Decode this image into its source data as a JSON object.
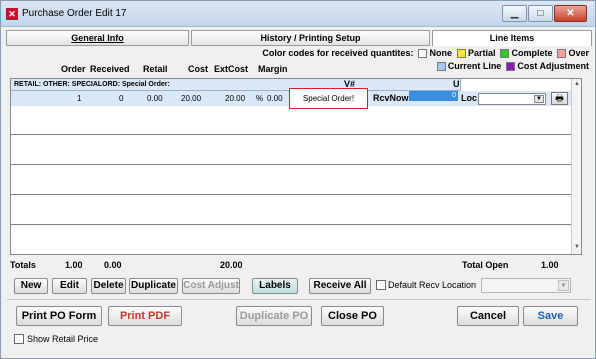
{
  "window": {
    "title": "Purchase Order Edit 17"
  },
  "tabs": {
    "general": "General Info",
    "history": "History / Printing Setup",
    "line_items": "Line Items"
  },
  "color_codes": {
    "label": "Color codes for received quantites:",
    "items": [
      {
        "label": "None",
        "color": "#ffffff"
      },
      {
        "label": "Partial",
        "color": "#f3ea22"
      },
      {
        "label": "Complete",
        "color": "#32c832"
      },
      {
        "label": "Over",
        "color": "#f3a0a0"
      }
    ],
    "row2": [
      {
        "label": "Current Line",
        "color": "#a8c8f0"
      },
      {
        "label": "Cost Adjustment",
        "color": "#8a1ea8"
      }
    ]
  },
  "columns": {
    "order": "Order",
    "received": "Received",
    "retail": "Retail",
    "cost": "Cost",
    "extcost": "ExtCost",
    "margin": "Margin"
  },
  "line": {
    "description": "RETAIL: OTHER: SPECIALORD: Special Order:",
    "vnum_label": "V#",
    "upc_label": "UPC",
    "order": "1",
    "received": "0",
    "retail": "0.00",
    "cost": "20.00",
    "extcost": "20.00",
    "margin_unit": "%",
    "margin": "0.00",
    "special": "Special Order!",
    "rcvnow_label": "RcvNow",
    "rcvnow_value": "0",
    "loc_label": "Loc"
  },
  "totals": {
    "label": "Totals",
    "order": "1.00",
    "received": "0.00",
    "extcost": "20.00",
    "open_label": "Total Open",
    "open_value": "1.00"
  },
  "buttons": {
    "new": "New",
    "edit": "Edit",
    "delete": "Delete",
    "duplicate": "Duplicate",
    "cost_adjust": "Cost Adjust",
    "labels": "Labels",
    "receive_all": "Receive All",
    "print_po": "Print PO Form",
    "print_pdf": "Print PDF",
    "duplicate_po": "Duplicate PO",
    "close_po": "Close PO",
    "cancel": "Cancel",
    "save": "Save"
  },
  "default_recv": {
    "label": "Default Recv Location"
  },
  "show_retail": {
    "label": "Show Retail Price"
  }
}
